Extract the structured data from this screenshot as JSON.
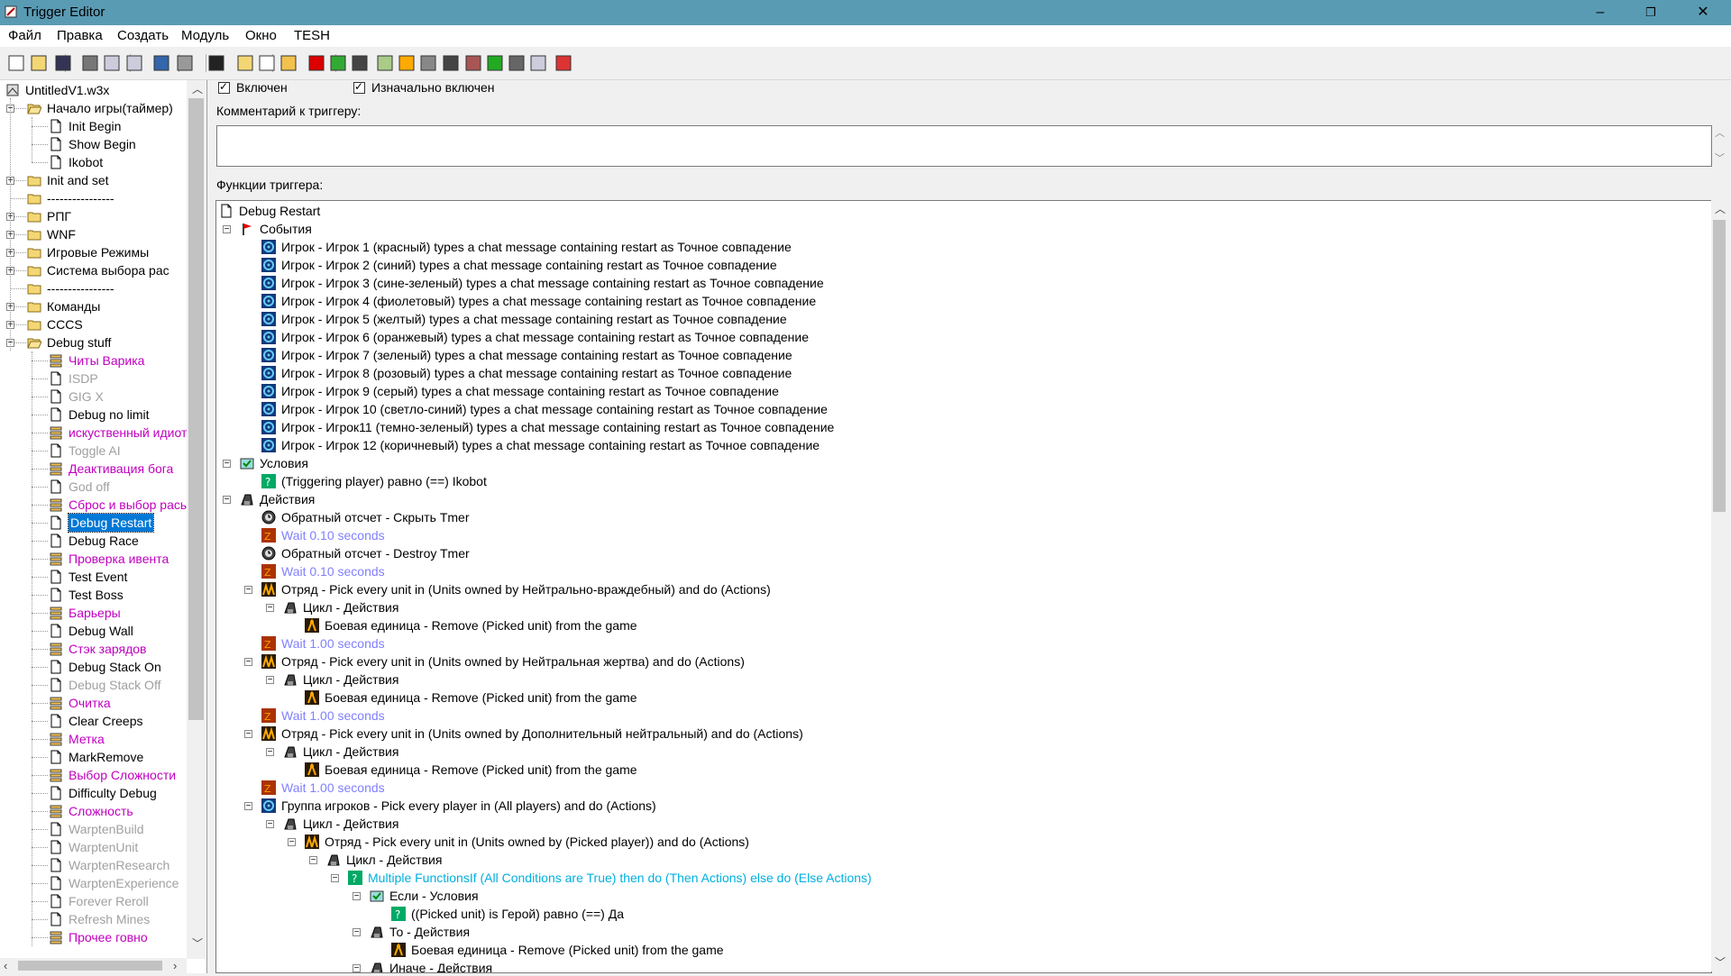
{
  "window": {
    "title": "Trigger Editor",
    "minimize": "–",
    "maximize": "❐",
    "close": "✕"
  },
  "menu": [
    "Файл",
    "Правка",
    "Создать",
    "Модуль",
    "Окно",
    "TESH"
  ],
  "tree": {
    "items": [
      {
        "label": "UntitledV1.w3x",
        "type": "map",
        "depth": 0
      },
      {
        "label": "Начало игры(таймер)",
        "type": "folder-open",
        "depth": 0,
        "expander": "−"
      },
      {
        "label": "Init Begin",
        "type": "doc",
        "depth": 1
      },
      {
        "label": "Show Begin",
        "type": "doc",
        "depth": 1
      },
      {
        "label": "Ikobot",
        "type": "doc",
        "depth": 1
      },
      {
        "label": "Init and set",
        "type": "folder",
        "depth": 0,
        "expander": "+"
      },
      {
        "label": "----------------",
        "type": "folder",
        "depth": 0
      },
      {
        "label": "РПГ",
        "type": "folder",
        "depth": 0,
        "expander": "+"
      },
      {
        "label": "WNF",
        "type": "folder",
        "depth": 0,
        "expander": "+"
      },
      {
        "label": "Игровые Режимы",
        "type": "folder",
        "depth": 0,
        "expander": "+"
      },
      {
        "label": "Система выбора рас",
        "type": "folder",
        "depth": 0,
        "expander": "+"
      },
      {
        "label": "----------------",
        "type": "folder",
        "depth": 0
      },
      {
        "label": "Команды",
        "type": "folder",
        "depth": 0,
        "expander": "+"
      },
      {
        "label": "CCCS",
        "type": "folder",
        "depth": 0,
        "expander": "+"
      },
      {
        "label": "Debug stuff",
        "type": "folder-open",
        "depth": 0,
        "expander": "−"
      },
      {
        "label": "Читы Варика",
        "type": "script",
        "depth": 1,
        "style": "purple"
      },
      {
        "label": "ISDP",
        "type": "doc",
        "depth": 1,
        "style": "disabled"
      },
      {
        "label": "GIG X",
        "type": "doc",
        "depth": 1,
        "style": "disabled"
      },
      {
        "label": "Debug no limit",
        "type": "doc",
        "depth": 1
      },
      {
        "label": "искуственный идиот",
        "type": "script",
        "depth": 1,
        "style": "purple"
      },
      {
        "label": "Toggle AI",
        "type": "doc",
        "depth": 1,
        "style": "disabled"
      },
      {
        "label": "Деактивация бога",
        "type": "script",
        "depth": 1,
        "style": "purple"
      },
      {
        "label": "God off",
        "type": "doc",
        "depth": 1,
        "style": "disabled"
      },
      {
        "label": "Сброс и выбор расы",
        "type": "script",
        "depth": 1,
        "style": "purple"
      },
      {
        "label": "Debug Restart",
        "type": "doc",
        "depth": 1,
        "style": "selected"
      },
      {
        "label": "Debug Race",
        "type": "doc",
        "depth": 1
      },
      {
        "label": "Проверка ивента",
        "type": "script",
        "depth": 1,
        "style": "purple"
      },
      {
        "label": "Test Event",
        "type": "doc",
        "depth": 1
      },
      {
        "label": "Test Boss",
        "type": "doc",
        "depth": 1
      },
      {
        "label": "Барьеры",
        "type": "script",
        "depth": 1,
        "style": "purple"
      },
      {
        "label": "Debug Wall",
        "type": "doc",
        "depth": 1
      },
      {
        "label": "Стэк зарядов",
        "type": "script",
        "depth": 1,
        "style": "purple"
      },
      {
        "label": "Debug Stack On",
        "type": "doc",
        "depth": 1
      },
      {
        "label": "Debug Stack Off",
        "type": "doc",
        "depth": 1,
        "style": "disabled"
      },
      {
        "label": "Очитка",
        "type": "script",
        "depth": 1,
        "style": "purple"
      },
      {
        "label": "Clear Creeps",
        "type": "doc",
        "depth": 1
      },
      {
        "label": "Метка",
        "type": "script",
        "depth": 1,
        "style": "purple"
      },
      {
        "label": "MarkRemove",
        "type": "doc",
        "depth": 1
      },
      {
        "label": "Выбор Сложности",
        "type": "script",
        "depth": 1,
        "style": "purple"
      },
      {
        "label": "Difficulty Debug",
        "type": "doc",
        "depth": 1
      },
      {
        "label": "Сложность",
        "type": "script",
        "depth": 1,
        "style": "purple"
      },
      {
        "label": "WarptenBuild",
        "type": "doc",
        "depth": 1,
        "style": "disabled"
      },
      {
        "label": "WarptenUnit",
        "type": "doc",
        "depth": 1,
        "style": "disabled"
      },
      {
        "label": "WarptenResearch",
        "type": "doc",
        "depth": 1,
        "style": "disabled"
      },
      {
        "label": "WarptenExperience",
        "type": "doc",
        "depth": 1,
        "style": "disabled"
      },
      {
        "label": "Forever Reroll",
        "type": "doc",
        "depth": 1,
        "style": "disabled"
      },
      {
        "label": "Refresh Mines",
        "type": "doc",
        "depth": 1,
        "style": "disabled"
      },
      {
        "label": "Прочее говно",
        "type": "script",
        "depth": 1,
        "style": "purple"
      }
    ]
  },
  "trigger": {
    "enabled_label": "Включен",
    "initially_enabled_label": "Изначально включен",
    "comment_label": "Комментарий к триггеру:",
    "functions_label": "Функции триггера:"
  },
  "functions": [
    {
      "label": "Debug Restart",
      "icon": "doc",
      "depth": 0
    },
    {
      "label": "События",
      "icon": "events",
      "depth": 0,
      "expander": "−"
    },
    {
      "label": "Игрок - Игрок 1 (красный) types a chat message containing restart as Точное совпадение",
      "icon": "player",
      "depth": 1
    },
    {
      "label": "Игрок - Игрок 2 (синий) types a chat message containing restart as Точное совпадение",
      "icon": "player",
      "depth": 1
    },
    {
      "label": "Игрок - Игрок 3 (сине-зеленый) types a chat message containing restart as Точное совпадение",
      "icon": "player",
      "depth": 1
    },
    {
      "label": "Игрок - Игрок 4 (фиолетовый) types a chat message containing restart as Точное совпадение",
      "icon": "player",
      "depth": 1
    },
    {
      "label": "Игрок - Игрок 5 (желтый) types a chat message containing restart as Точное совпадение",
      "icon": "player",
      "depth": 1
    },
    {
      "label": "Игрок - Игрок 6 (оранжевый) types a chat message containing restart as Точное совпадение",
      "icon": "player",
      "depth": 1
    },
    {
      "label": "Игрок - Игрок 7 (зеленый) types a chat message containing restart as Точное совпадение",
      "icon": "player",
      "depth": 1
    },
    {
      "label": "Игрок - Игрок 8 (розовый) types a chat message containing restart as Точное совпадение",
      "icon": "player",
      "depth": 1
    },
    {
      "label": "Игрок - Игрок 9 (серый) types a chat message containing restart as Точное совпадение",
      "icon": "player",
      "depth": 1
    },
    {
      "label": "Игрок - Игрок 10 (светло-синий) types a chat message containing restart as Точное совпадение",
      "icon": "player",
      "depth": 1
    },
    {
      "label": "Игрок - Игрок11 (темно-зеленый) types a chat message containing restart as Точное совпадение",
      "icon": "player",
      "depth": 1
    },
    {
      "label": "Игрок - Игрок 12 (коричневый) types a chat message containing restart as Точное совпадение",
      "icon": "player",
      "depth": 1
    },
    {
      "label": "Условия",
      "icon": "conditions",
      "depth": 0,
      "expander": "−"
    },
    {
      "label": "(Triggering player) равно (==) Ikobot",
      "icon": "condition",
      "depth": 1
    },
    {
      "label": "Действия",
      "icon": "actions",
      "depth": 0,
      "expander": "−"
    },
    {
      "label": "Обратный отсчет - Скрыть Tmer",
      "icon": "timer",
      "depth": 1
    },
    {
      "label": "Wait 0.10 seconds",
      "icon": "wait",
      "depth": 1,
      "style": "blue"
    },
    {
      "label": "Обратный отсчет - Destroy Tmer",
      "icon": "timer",
      "depth": 1
    },
    {
      "label": "Wait 0.10 seconds",
      "icon": "wait",
      "depth": 1,
      "style": "blue"
    },
    {
      "label": "Отряд - Pick every unit in (Units owned by Нейтрально-враждебный) and do (Actions)",
      "icon": "group",
      "depth": 1,
      "expander": "−"
    },
    {
      "label": "Цикл - Действия",
      "icon": "actions",
      "depth": 2,
      "expander": "−"
    },
    {
      "label": "Боевая единица - Remove (Picked unit) from the game",
      "icon": "unit",
      "depth": 3
    },
    {
      "label": "Wait 1.00 seconds",
      "icon": "wait",
      "depth": 1,
      "style": "blue"
    },
    {
      "label": "Отряд - Pick every unit in (Units owned by Нейтральная жертва) and do (Actions)",
      "icon": "group",
      "depth": 1,
      "expander": "−"
    },
    {
      "label": "Цикл - Действия",
      "icon": "actions",
      "depth": 2,
      "expander": "−"
    },
    {
      "label": "Боевая единица - Remove (Picked unit) from the game",
      "icon": "unit",
      "depth": 3
    },
    {
      "label": "Wait 1.00 seconds",
      "icon": "wait",
      "depth": 1,
      "style": "blue"
    },
    {
      "label": "Отряд - Pick every unit in (Units owned by Дополнительный нейтральный) and do (Actions)",
      "icon": "group",
      "depth": 1,
      "expander": "−"
    },
    {
      "label": "Цикл - Действия",
      "icon": "actions",
      "depth": 2,
      "expander": "−"
    },
    {
      "label": "Боевая единица - Remove (Picked unit) from the game",
      "icon": "unit",
      "depth": 3
    },
    {
      "label": "Wait 1.00 seconds",
      "icon": "wait",
      "depth": 1,
      "style": "blue"
    },
    {
      "label": "Группа игроков - Pick every player in (All players) and do (Actions)",
      "icon": "player",
      "depth": 1,
      "expander": "−"
    },
    {
      "label": "Цикл - Действия",
      "icon": "actions",
      "depth": 2,
      "expander": "−"
    },
    {
      "label": "Отряд - Pick every unit in (Units owned by (Picked player)) and do (Actions)",
      "icon": "group",
      "depth": 3,
      "expander": "−"
    },
    {
      "label": "Цикл - Действия",
      "icon": "actions",
      "depth": 4,
      "expander": "−"
    },
    {
      "label": "Multiple FunctionsIf (All Conditions are True) then do (Then Actions) else do (Else Actions)",
      "icon": "condition",
      "depth": 5,
      "expander": "−",
      "style": "cyan"
    },
    {
      "label": "Если - Условия",
      "icon": "conditions",
      "depth": 6,
      "expander": "−"
    },
    {
      "label": "((Picked unit) is Герой) равно (==) Да",
      "icon": "condition",
      "depth": 7
    },
    {
      "label": "То - Действия",
      "icon": "actions",
      "depth": 6,
      "expander": "−"
    },
    {
      "label": "Боевая единица - Remove (Picked unit) from the game",
      "icon": "unit",
      "depth": 7
    },
    {
      "label": "Иначе - Действия",
      "icon": "actions",
      "depth": 6,
      "expander": "−"
    }
  ],
  "toolbar_icons": [
    "new-icon",
    "open-icon",
    "save-icon",
    "cut-icon",
    "copy-icon",
    "paste-icon",
    "undo-icon",
    "redo-icon",
    "delete-icon",
    "new-category-icon",
    "new-trigger-icon",
    "new-comment-icon",
    "new-event-icon",
    "new-condition-icon",
    "new-action-icon",
    "terrain-editor-icon",
    "unit-editor-icon",
    "sound-editor-icon",
    "object-editor-icon",
    "campaign-editor-icon",
    "ai-editor-icon",
    "object-manager-icon",
    "import-manager-icon",
    "test-map-icon"
  ]
}
